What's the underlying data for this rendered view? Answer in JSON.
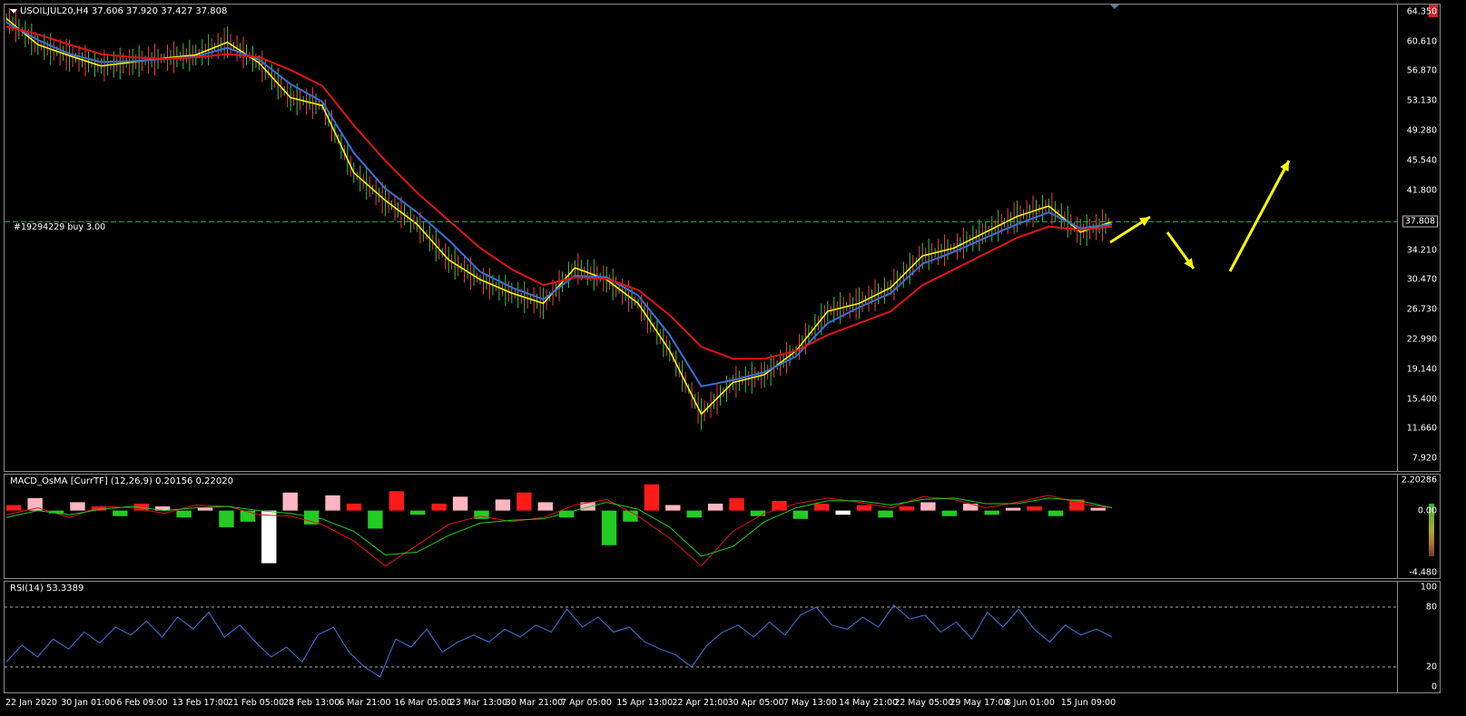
{
  "main": {
    "symbol_info": "USOILJUL20,H4  37.606 37.920 37.427 37.808",
    "order_label": "#19294229 buy 3.00",
    "price_ticks": [
      "64.350",
      "60.610",
      "56.870",
      "53.130",
      "49.280",
      "45.540",
      "41.800",
      "37.808",
      "34.210",
      "30.470",
      "26.730",
      "22.990",
      "19.140",
      "15.400",
      "11.660",
      "7.920"
    ],
    "current_price": "37.808",
    "colors": {
      "price": "#ffff00",
      "fast_ma": "#3b6fd8",
      "slow_ma": "#e01515",
      "order_line": "#3aa655",
      "arrows": "#ffff00"
    }
  },
  "macd": {
    "label": "MACD_OsMA [CurrTF] (12,26,9) 0.20156 0.22020",
    "ticks": [
      "2.20286",
      "0.00",
      "-4.480"
    ]
  },
  "rsi": {
    "label": "RSI(14) 53.3389",
    "ticks": [
      "100",
      "80",
      "20",
      "0"
    ]
  },
  "time_axis": [
    "22 Jan 2020",
    "30 Jan 01:00",
    "6 Feb 09:00",
    "13 Feb 17:00",
    "21 Feb 05:00",
    "28 Feb 13:00",
    "6 Mar 21:00",
    "16 Mar 05:00",
    "23 Mar 13:00",
    "30 Mar 21:00",
    "7 Apr 05:00",
    "15 Apr 13:00",
    "22 Apr 21:00",
    "30 Apr 05:00",
    "7 May 13:00",
    "14 May 21:00",
    "22 May 05:00",
    "29 May 17:00",
    "8 Jun 01:00",
    "15 Jun 09:00"
  ],
  "chart_data": [
    {
      "type": "line",
      "title": "USOILJUL20,H4",
      "ylim": [
        7.92,
        64.35
      ],
      "series": [
        {
          "values": [
            63.5,
            60.2,
            58.8,
            57.5,
            58.0,
            58.5,
            58.9,
            60.5,
            57.9,
            53.5,
            52.5,
            44.0,
            40.5,
            37.5,
            33.0,
            30.5,
            28.8,
            27.5,
            32.0,
            30.5,
            27.5,
            21.5,
            13.5,
            17.5,
            18.5,
            21.5,
            26.5,
            27.5,
            29.5,
            33.5,
            34.5,
            36.5,
            38.5,
            39.8,
            36.5,
            37.8
          ]
        },
        {
          "values": [
            63.0,
            60.8,
            59.0,
            58.0,
            58.1,
            58.4,
            58.7,
            59.8,
            58.3,
            55.2,
            53.0,
            46.5,
            42.0,
            39.0,
            35.5,
            31.5,
            29.5,
            28.0,
            31.0,
            30.8,
            28.5,
            23.5,
            17.0,
            17.8,
            18.8,
            20.8,
            25.0,
            27.0,
            28.8,
            32.5,
            34.0,
            35.8,
            37.5,
            39.0,
            37.0,
            37.5
          ]
        },
        {
          "values": [
            62.5,
            61.5,
            60.2,
            59.0,
            58.6,
            58.4,
            58.6,
            59.0,
            58.6,
            57.0,
            55.0,
            50.0,
            45.5,
            41.5,
            38.0,
            34.5,
            31.8,
            29.8,
            30.8,
            30.6,
            29.2,
            26.0,
            22.0,
            20.5,
            20.5,
            21.5,
            23.5,
            25.0,
            26.5,
            29.8,
            31.8,
            33.8,
            35.8,
            37.2,
            36.8,
            37.2
          ]
        }
      ]
    },
    {
      "type": "bar",
      "title": "MACD_OsMA [CurrTF] (12,26,9)",
      "ylim": [
        -4.48,
        2.20286
      ],
      "values": [
        0.4,
        0.9,
        -0.2,
        0.6,
        0.3,
        -0.4,
        0.5,
        0.3,
        -0.5,
        0.2,
        -1.2,
        -0.8,
        -3.8,
        1.3,
        -1.0,
        1.1,
        0.5,
        -1.3,
        1.4,
        -0.3,
        0.5,
        1.0,
        -0.6,
        0.8,
        1.3,
        0.6,
        -0.5,
        0.6,
        -2.5,
        -0.8,
        1.9,
        0.4,
        -0.5,
        0.5,
        0.9,
        -0.4,
        0.7,
        -0.6,
        0.5,
        -0.3,
        0.4,
        -0.5,
        0.3,
        0.6,
        -0.4,
        0.5,
        -0.3,
        0.2,
        0.3,
        -0.4,
        0.8,
        0.2
      ],
      "series": [
        {
          "values": [
            -0.3,
            0.2,
            -0.5,
            0.3,
            0.2,
            -0.2,
            0.4,
            0.3,
            -0.3,
            -0.4,
            -1.0,
            -2.2,
            -4.0,
            -2.5,
            -1.0,
            -0.4,
            -0.8,
            -0.5,
            0.4,
            0.8,
            -0.4,
            -2.0,
            -4.0,
            -1.5,
            -0.2,
            0.5,
            0.9,
            0.6,
            0.2,
            1.0,
            0.8,
            0.2,
            0.6,
            1.1,
            0.5,
            0.2
          ]
        },
        {
          "values": [
            -0.5,
            0.0,
            -0.3,
            0.1,
            0.3,
            0.0,
            0.2,
            0.3,
            0.0,
            -0.2,
            -0.6,
            -1.5,
            -3.2,
            -3.0,
            -1.8,
            -0.9,
            -0.7,
            -0.6,
            0.0,
            0.6,
            0.1,
            -1.2,
            -3.3,
            -2.6,
            -0.8,
            0.2,
            0.7,
            0.7,
            0.4,
            0.8,
            0.9,
            0.5,
            0.5,
            0.9,
            0.7,
            0.2
          ]
        }
      ]
    },
    {
      "type": "line",
      "title": "RSI(14)",
      "ylim": [
        0,
        100
      ],
      "values": [
        25,
        42,
        30,
        48,
        38,
        55,
        44,
        60,
        52,
        66,
        50,
        70,
        58,
        75,
        50,
        62,
        45,
        30,
        40,
        25,
        52,
        60,
        35,
        20,
        10,
        48,
        40,
        58,
        35,
        45,
        52,
        45,
        58,
        50,
        62,
        55,
        78,
        60,
        70,
        55,
        60,
        45,
        38,
        32,
        20,
        42,
        55,
        62,
        50,
        65,
        52,
        72,
        80,
        62,
        58,
        70,
        60,
        82,
        68,
        72,
        55,
        65,
        48,
        75,
        60,
        78,
        58,
        45,
        62,
        52,
        58,
        50
      ],
      "ticks": [
        100,
        80,
        20,
        0
      ]
    }
  ]
}
